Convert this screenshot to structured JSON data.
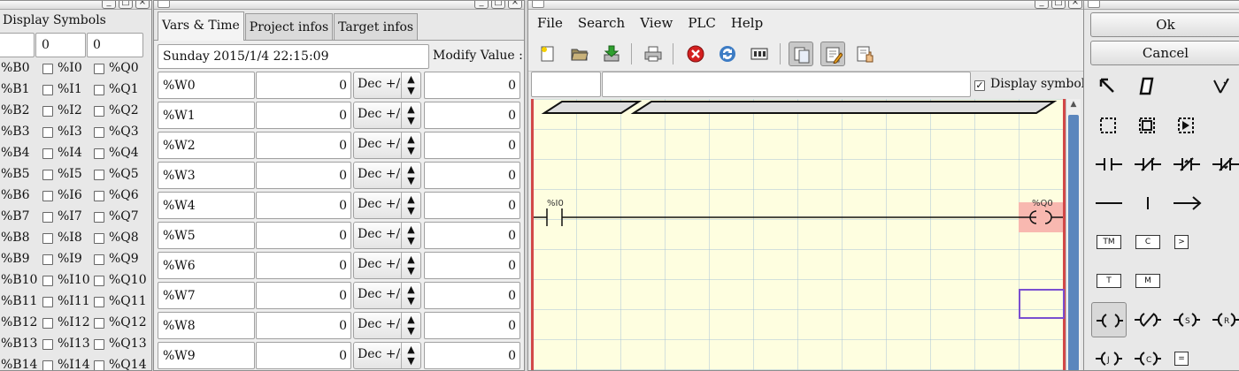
{
  "bools": {
    "title": "Display Symbols",
    "inputs": [
      "",
      "0",
      "0"
    ],
    "rows": [
      [
        "%B0",
        "%I0",
        "%Q0"
      ],
      [
        "%B1",
        "%I1",
        "%Q1"
      ],
      [
        "%B2",
        "%I2",
        "%Q2"
      ],
      [
        "%B3",
        "%I3",
        "%Q3"
      ],
      [
        "%B4",
        "%I4",
        "%Q4"
      ],
      [
        "%B5",
        "%I5",
        "%Q5"
      ],
      [
        "%B6",
        "%I6",
        "%Q6"
      ],
      [
        "%B7",
        "%I7",
        "%Q7"
      ],
      [
        "%B8",
        "%I8",
        "%Q8"
      ],
      [
        "%B9",
        "%I9",
        "%Q9"
      ],
      [
        "%B10",
        "%I10",
        "%Q10"
      ],
      [
        "%B11",
        "%I11",
        "%Q11"
      ],
      [
        "%B12",
        "%I12",
        "%Q12"
      ],
      [
        "%B13",
        "%I13",
        "%Q13"
      ],
      [
        "%B14",
        "%I14",
        "%Q14"
      ]
    ]
  },
  "freevars": {
    "tabs": [
      "Vars & Time",
      "Project infos",
      "Target infos"
    ],
    "datetime": "Sunday 2015/1/4 22:15:09",
    "modify_label": "Modify Value :",
    "rows": [
      {
        "name": "%W0",
        "value": "0",
        "format": "Dec +/-",
        "modify": "0"
      },
      {
        "name": "%W1",
        "value": "0",
        "format": "Dec +/-",
        "modify": "0"
      },
      {
        "name": "%W2",
        "value": "0",
        "format": "Dec +/-",
        "modify": "0"
      },
      {
        "name": "%W3",
        "value": "0",
        "format": "Dec +/-",
        "modify": "0"
      },
      {
        "name": "%W4",
        "value": "0",
        "format": "Dec +/-",
        "modify": "0"
      },
      {
        "name": "%W5",
        "value": "0",
        "format": "Dec +/-",
        "modify": "0"
      },
      {
        "name": "%W6",
        "value": "0",
        "format": "Dec +/-",
        "modify": "0"
      },
      {
        "name": "%W7",
        "value": "0",
        "format": "Dec +/-",
        "modify": "0"
      },
      {
        "name": "%W8",
        "value": "0",
        "format": "Dec +/-",
        "modify": "0"
      },
      {
        "name": "%W9",
        "value": "0",
        "format": "Dec +/-",
        "modify": "0"
      }
    ]
  },
  "section": {
    "menus": [
      "File",
      "Search",
      "View",
      "PLC",
      "Help"
    ],
    "display_symbols_label": "Display symbols",
    "display_symbols_checked": true,
    "contact_label": "%I0",
    "coil_label": "%Q0"
  },
  "editor": {
    "ok_label": "Ok",
    "cancel_label": "Cancel",
    "tool_labels": {
      "tm": "TM",
      "c": "C",
      "gt": ">",
      "t": "T",
      "m": "M",
      "eq": "="
    }
  },
  "colors": {
    "rail": "#d24848",
    "ladder_bg": "#fefee0",
    "coil_highlight": "#f8b8b0",
    "selection": "#7a4fd0",
    "scroll_thumb": "#5b86bd"
  }
}
